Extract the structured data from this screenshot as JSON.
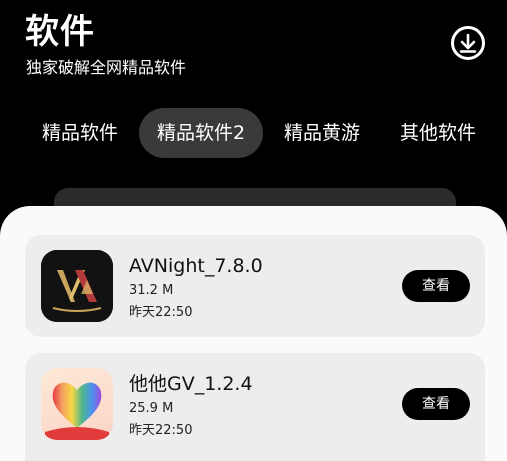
{
  "header": {
    "title": "软件",
    "subtitle": "独家破解全网精品软件",
    "download_icon": "download-circle-icon"
  },
  "tabs": [
    {
      "label": "精品软件",
      "active": false
    },
    {
      "label": "精品软件2",
      "active": true
    },
    {
      "label": "精品黄游",
      "active": false
    },
    {
      "label": "其他软件",
      "active": false
    }
  ],
  "apps": [
    {
      "name": "AVNight_7.8.0",
      "size": "31.2 M",
      "date": "昨天22:50",
      "button": "查看",
      "icon": "avnight-logo-icon"
    },
    {
      "name": "他他GV_1.2.4",
      "size": "25.9 M",
      "date": "昨天22:50",
      "button": "查看",
      "icon": "rainbow-heart-icon"
    }
  ],
  "colors": {
    "background": "#000000",
    "sheet": "#fafafa",
    "card": "#ededed",
    "active_tab": "#3a3a3a",
    "button": "#000000"
  }
}
